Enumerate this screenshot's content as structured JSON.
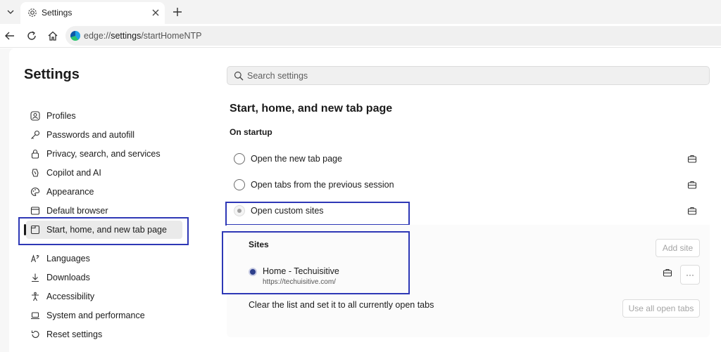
{
  "browser": {
    "tab_title": "Settings",
    "url_prefix": "edge://",
    "url_bold": "settings",
    "url_suffix": "/startHomeNTP"
  },
  "sidebar": {
    "title": "Settings",
    "items": [
      {
        "label": "Profiles",
        "icon": "profile-icon"
      },
      {
        "label": "Passwords and autofill",
        "icon": "key-icon"
      },
      {
        "label": "Privacy, search, and services",
        "icon": "lock-icon"
      },
      {
        "label": "Copilot and AI",
        "icon": "copilot-icon"
      },
      {
        "label": "Appearance",
        "icon": "palette-icon"
      },
      {
        "label": "Default browser",
        "icon": "browser-icon"
      },
      {
        "label": "Start, home, and new tab page",
        "icon": "home-tab-icon",
        "active": true
      },
      {
        "label": "Languages",
        "icon": "languages-icon"
      },
      {
        "label": "Downloads",
        "icon": "download-icon"
      },
      {
        "label": "Accessibility",
        "icon": "accessibility-icon"
      },
      {
        "label": "System and performance",
        "icon": "laptop-icon"
      },
      {
        "label": "Reset settings",
        "icon": "reset-icon"
      }
    ]
  },
  "search": {
    "placeholder": "Search settings"
  },
  "main": {
    "heading": "Start, home, and new tab page",
    "startup_label": "On startup",
    "options": [
      {
        "label": "Open the new tab page",
        "selected": false
      },
      {
        "label": "Open tabs from the previous session",
        "selected": false
      },
      {
        "label": "Open custom sites",
        "selected": true
      }
    ],
    "sites": {
      "title": "Sites",
      "add_button": "Add site",
      "entries": [
        {
          "name": "Home - Techuisitive",
          "url": "https://techuisitive.com/"
        }
      ],
      "more_button": "···",
      "clear_text": "Clear the list and set it to all currently open tabs",
      "use_open_tabs_button": "Use all open tabs"
    }
  },
  "colors": {
    "highlight_box": "#2e38b6",
    "selected_site_radio": "#2d3f8c"
  }
}
